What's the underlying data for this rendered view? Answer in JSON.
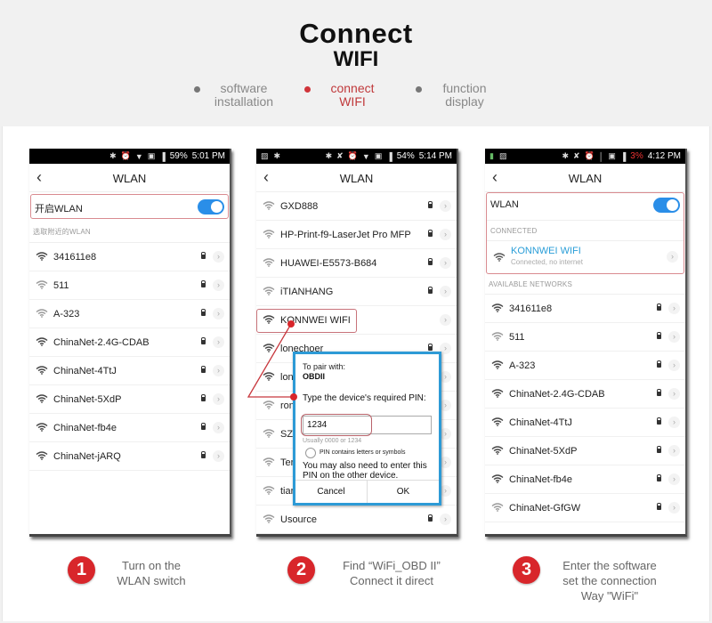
{
  "header": {
    "title_line1": "Connect",
    "title_line2": "WIFI",
    "nav": [
      {
        "line1": "software",
        "line2": "installation",
        "active": false
      },
      {
        "line1": "connect",
        "line2": "WIFI",
        "active": true
      },
      {
        "line1": "function",
        "line2": "display",
        "active": false
      }
    ]
  },
  "colors": {
    "accent_red": "#d8262b",
    "toggle_blue": "#2a8ee8",
    "dialog_blue": "#2d9ad6",
    "connected_ssid": "#2a9ed8"
  },
  "screen1": {
    "status": {
      "icons": [
        "bluetooth-icon",
        "alarm-icon",
        "wifi-icon",
        "sim-icon",
        "signal-icon"
      ],
      "battery": "59%",
      "time": "5:01 PM"
    },
    "title": "WLAN",
    "toggle_label": "开启WLAN",
    "toggle_on": true,
    "section_label": "选取附近的WLAN",
    "networks": [
      "341611e8",
      "511",
      "A-323",
      "ChinaNet-2.4G-CDAB",
      "ChinaNet-4TtJ",
      "ChinaNet-5XdP",
      "ChinaNet-fb4e",
      "ChinaNet-jARQ"
    ]
  },
  "screen2": {
    "status": {
      "icons": [
        "image-icon",
        "bluetooth-icon",
        "bluetooth-icon",
        "mute-icon",
        "alarm-icon",
        "wifi-icon",
        "sim-icon",
        "signal-icon"
      ],
      "battery": "54%",
      "time": "5:14 PM"
    },
    "title": "WLAN",
    "networks": [
      "GXD888",
      "HP-Print-f9-LaserJet Pro MFP",
      "HUAWEI-E5573-B684",
      "iTIANHANG",
      "KONNWEI WIFI",
      "lonechoer",
      "lon",
      "ron",
      "SZ",
      "Ten",
      "tian",
      "Usource"
    ],
    "dialog": {
      "pair_with_label": "To pair with:",
      "device_name": "OBDII",
      "pin_prompt": "Type the device's required PIN:",
      "pin_value": "1234",
      "pin_hint": "Usually 0000 or 1234",
      "checkbox_label": "PIN contains letters or symbols",
      "note": "You may also need to enter this PIN on the other device.",
      "cancel_label": "Cancel",
      "ok_label": "OK"
    }
  },
  "screen3": {
    "status": {
      "icons": [
        "battery-saver-icon",
        "image-icon",
        "bluetooth-icon",
        "mute-icon",
        "alarm-icon",
        "wifi-icon",
        "sim-icon",
        "signal-icon"
      ],
      "battery": "3%",
      "time": "4:12 PM"
    },
    "title": "WLAN",
    "toggle_label": "WLAN",
    "toggle_on": true,
    "connected_label": "CONNECTED",
    "connected_ssid": "KONNWEI WIFI",
    "connected_status": "Connected, no internet",
    "available_label": "AVAILABLE NETWORKS",
    "networks": [
      "341611e8",
      "511",
      "A-323",
      "ChinaNet-2.4G-CDAB",
      "ChinaNet-4TtJ",
      "ChinaNet-5XdP",
      "ChinaNet-fb4e",
      "ChinaNet-GfGW"
    ]
  },
  "steps": [
    {
      "number": "1",
      "line1": "Turn on the",
      "line2": "WLAN switch",
      "line3": ""
    },
    {
      "number": "2",
      "line1": "Find “WiFi_OBD II”",
      "line2": "Connect it direct",
      "line3": ""
    },
    {
      "number": "3",
      "line1": "Enter the software",
      "line2": "set the connection",
      "line3": "Way \"WiFi\""
    }
  ]
}
